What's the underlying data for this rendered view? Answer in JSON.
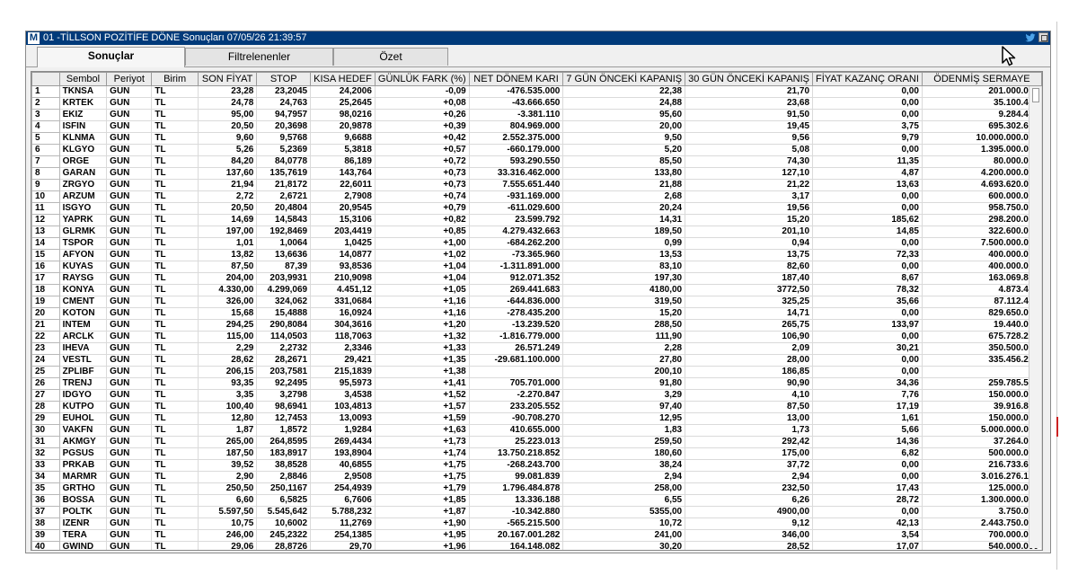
{
  "window": {
    "app_icon": "M",
    "title": "01 -TİLLSON POZİTİFE DÖNE Sonuçları  07/05/26 21:39:57",
    "twitter_icon": "twitter-icon",
    "restore_icon": "restore-icon"
  },
  "tabs": [
    {
      "label": "Sonuçlar",
      "active": true
    },
    {
      "label": "Filtrelenenler",
      "active": false
    },
    {
      "label": "Özet",
      "active": false
    }
  ],
  "table": {
    "columns": [
      "",
      "Sembol",
      "Periyot",
      "Birim",
      "SON FİYAT",
      "STOP",
      "KISA HEDEF",
      "GÜNLÜK FARK (%)",
      "NET DÖNEM KARI",
      "7 GÜN ÖNCEKİ KAPANIŞ",
      "30 GÜN ÖNCEKİ KAPANIŞ",
      "FİYAT KAZANÇ ORANI",
      "ÖDENMİŞ SERMAYE"
    ],
    "rows": [
      [
        "1",
        "TKNSA",
        "GUN",
        "TL",
        "23,28",
        "23,2045",
        "24,2006",
        "-0,09",
        "-476.535.000",
        "22,38",
        "21,70",
        "0,00",
        "201.000.000"
      ],
      [
        "2",
        "KRTEK",
        "GUN",
        "TL",
        "24,78",
        "24,763",
        "25,2645",
        "+0,08",
        "-43.666.650",
        "24,88",
        "23,68",
        "0,00",
        "35.100.498"
      ],
      [
        "3",
        "EKIZ",
        "GUN",
        "TL",
        "95,00",
        "94,7957",
        "98,0216",
        "+0,26",
        "-3.381.110",
        "95,60",
        "91,50",
        "0,00",
        "9.284.470"
      ],
      [
        "4",
        "ISFIN",
        "GUN",
        "TL",
        "20,50",
        "20,3698",
        "20,9878",
        "+0,39",
        "804.969.000",
        "20,00",
        "19,45",
        "3,75",
        "695.302.645"
      ],
      [
        "5",
        "KLNMA",
        "GUN",
        "TL",
        "9,60",
        "9,5768",
        "9,6688",
        "+0,42",
        "2.552.375.000",
        "9,50",
        "9,56",
        "9,79",
        "10.000.000.000"
      ],
      [
        "6",
        "KLGYO",
        "GUN",
        "TL",
        "5,26",
        "5,2369",
        "5,3818",
        "+0,57",
        "-660.179.000",
        "5,20",
        "5,08",
        "0,00",
        "1.395.000.000"
      ],
      [
        "7",
        "ORGE",
        "GUN",
        "TL",
        "84,20",
        "84,0778",
        "86,189",
        "+0,72",
        "593.290.550",
        "85,50",
        "74,30",
        "11,35",
        "80.000.000"
      ],
      [
        "8",
        "GARAN",
        "GUN",
        "TL",
        "137,60",
        "135,7619",
        "143,764",
        "+0,73",
        "33.316.462.000",
        "133,80",
        "127,10",
        "4,87",
        "4.200.000.000"
      ],
      [
        "9",
        "ZRGYO",
        "GUN",
        "TL",
        "21,94",
        "21,8172",
        "22,6011",
        "+0,73",
        "7.555.651.440",
        "21,88",
        "21,22",
        "13,63",
        "4.693.620.000"
      ],
      [
        "10",
        "ARZUM",
        "GUN",
        "TL",
        "2,72",
        "2,6721",
        "2,7908",
        "+0,74",
        "-931.169.000",
        "2,68",
        "3,17",
        "0,00",
        "600.000.000"
      ],
      [
        "11",
        "ISGYO",
        "GUN",
        "TL",
        "20,50",
        "20,4804",
        "20,9545",
        "+0,79",
        "-611.029.600",
        "20,24",
        "19,56",
        "0,00",
        "958.750.000"
      ],
      [
        "12",
        "YAPRK",
        "GUN",
        "TL",
        "14,69",
        "14,5843",
        "15,3106",
        "+0,82",
        "23.599.792",
        "14,31",
        "15,20",
        "185,62",
        "298.200.000"
      ],
      [
        "13",
        "GLRMK",
        "GUN",
        "TL",
        "197,00",
        "192,8469",
        "203,4419",
        "+0,85",
        "4.279.432.663",
        "189,50",
        "201,10",
        "14,85",
        "322.600.000"
      ],
      [
        "14",
        "TSPOR",
        "GUN",
        "TL",
        "1,01",
        "1,0064",
        "1,0425",
        "+1,00",
        "-684.262.200",
        "0,99",
        "0,94",
        "0,00",
        "7.500.000.000"
      ],
      [
        "15",
        "AFYON",
        "GUN",
        "TL",
        "13,82",
        "13,6636",
        "14,0877",
        "+1,02",
        "-73.365.960",
        "13,53",
        "13,75",
        "72,33",
        "400.000.000"
      ],
      [
        "16",
        "KUYAS",
        "GUN",
        "TL",
        "87,50",
        "87,39",
        "93,8536",
        "+1,04",
        "-1.311.891.000",
        "83,10",
        "82,60",
        "0,00",
        "400.000.000"
      ],
      [
        "17",
        "RAYSG",
        "GUN",
        "TL",
        "204,00",
        "203,9931",
        "210,9098",
        "+1,04",
        "912.071.352",
        "197,30",
        "187,40",
        "8,67",
        "163.069.855"
      ],
      [
        "18",
        "KONYA",
        "GUN",
        "TL",
        "4.330,00",
        "4.299,069",
        "4.451,12",
        "+1,05",
        "269.441.683",
        "4180,00",
        "3772,50",
        "78,32",
        "4.873.440"
      ],
      [
        "19",
        "CMENT",
        "GUN",
        "TL",
        "326,00",
        "324,062",
        "331,0684",
        "+1,16",
        "-644.836.000",
        "319,50",
        "325,25",
        "35,66",
        "87.112.463"
      ],
      [
        "20",
        "KOTON",
        "GUN",
        "TL",
        "15,68",
        "15,4888",
        "16,0924",
        "+1,16",
        "-278.435.200",
        "15,20",
        "14,71",
        "0,00",
        "829.650.000"
      ],
      [
        "21",
        "INTEM",
        "GUN",
        "TL",
        "294,25",
        "290,8084",
        "304,3616",
        "+1,20",
        "-13.239.520",
        "288,50",
        "265,75",
        "133,97",
        "19.440.000"
      ],
      [
        "22",
        "ARCLK",
        "GUN",
        "TL",
        "115,00",
        "114,0503",
        "118,7063",
        "+1,32",
        "-1.816.779.000",
        "111,90",
        "106,90",
        "0,00",
        "675.728.205"
      ],
      [
        "23",
        "IHEVA",
        "GUN",
        "TL",
        "2,29",
        "2,2732",
        "2,3346",
        "+1,33",
        "26.571.249",
        "2,28",
        "2,09",
        "30,21",
        "350.500.000"
      ],
      [
        "24",
        "VESTL",
        "GUN",
        "TL",
        "28,62",
        "28,2671",
        "29,421",
        "+1,35",
        "-29.681.100.000",
        "27,80",
        "28,00",
        "0,00",
        "335.456.275"
      ],
      [
        "25",
        "ZPLIBF",
        "GUN",
        "TL",
        "206,15",
        "203,7581",
        "215,1839",
        "+1,38",
        "",
        "200,10",
        "186,85",
        "0,00",
        ""
      ],
      [
        "26",
        "TRENJ",
        "GUN",
        "TL",
        "93,35",
        "92,2495",
        "95,5973",
        "+1,41",
        "705.701.000",
        "91,80",
        "90,90",
        "34,36",
        "259.785.561"
      ],
      [
        "27",
        "IDGYO",
        "GUN",
        "TL",
        "3,35",
        "3,2798",
        "3,4538",
        "+1,52",
        "-2.270.847",
        "3,29",
        "4,10",
        "7,76",
        "150.000.000"
      ],
      [
        "28",
        "KUTPO",
        "GUN",
        "TL",
        "100,40",
        "98,6941",
        "103,4813",
        "+1,57",
        "233.205.552",
        "97,40",
        "87,50",
        "17,19",
        "39.916.800"
      ],
      [
        "29",
        "EUHOL",
        "GUN",
        "TL",
        "12,80",
        "12,7453",
        "13,0093",
        "+1,59",
        "-90.708.270",
        "12,95",
        "13,00",
        "1,61",
        "150.000.000"
      ],
      [
        "30",
        "VAKFN",
        "GUN",
        "TL",
        "1,87",
        "1,8572",
        "1,9284",
        "+1,63",
        "410.655.000",
        "1,83",
        "1,73",
        "5,66",
        "5.000.000.000"
      ],
      [
        "31",
        "AKMGY",
        "GUN",
        "TL",
        "265,00",
        "264,8595",
        "269,4434",
        "+1,73",
        "25.223.013",
        "259,50",
        "292,42",
        "14,36",
        "37.264.000"
      ],
      [
        "32",
        "PGSUS",
        "GUN",
        "TL",
        "187,50",
        "183,8917",
        "193,8904",
        "+1,74",
        "13.750.218.852",
        "180,60",
        "175,00",
        "6,82",
        "500.000.000"
      ],
      [
        "33",
        "PRKAB",
        "GUN",
        "TL",
        "39,52",
        "38,8528",
        "40,6855",
        "+1,75",
        "-268.243.700",
        "38,24",
        "37,72",
        "0,00",
        "216.733.652"
      ],
      [
        "34",
        "MARMR",
        "GUN",
        "TL",
        "2,90",
        "2,8846",
        "2,9508",
        "+1,75",
        "99.081.839",
        "2,94",
        "2,94",
        "0,00",
        "3.016.276.170"
      ],
      [
        "35",
        "GRTHO",
        "GUN",
        "TL",
        "250,50",
        "250,1167",
        "254,4939",
        "+1,79",
        "1.796.484.878",
        "258,00",
        "232,50",
        "17,43",
        "125.000.000"
      ],
      [
        "36",
        "BOSSA",
        "GUN",
        "TL",
        "6,60",
        "6,5825",
        "6,7606",
        "+1,85",
        "13.336.188",
        "6,55",
        "6,26",
        "28,72",
        "1.300.000.000"
      ],
      [
        "37",
        "POLTK",
        "GUN",
        "TL",
        "5.597,50",
        "5.545,642",
        "5.788,232",
        "+1,87",
        "-10.342.880",
        "5355,00",
        "4900,00",
        "0,00",
        "3.750.000"
      ],
      [
        "38",
        "IZENR",
        "GUN",
        "TL",
        "10,75",
        "10,6002",
        "11,2769",
        "+1,90",
        "-565.215.500",
        "10,72",
        "9,12",
        "42,13",
        "2.443.750.000"
      ],
      [
        "39",
        "TERA",
        "GUN",
        "TL",
        "246,00",
        "245,2322",
        "254,1385",
        "+1,95",
        "20.167.001.282",
        "241,00",
        "346,00",
        "3,54",
        "700.000.000"
      ],
      [
        "40",
        "GWIND",
        "GUN",
        "TL",
        "29,06",
        "28,8726",
        "29,70",
        "+1,96",
        "164.148.082",
        "30,20",
        "28,52",
        "17,07",
        "540.000.000"
      ]
    ]
  }
}
